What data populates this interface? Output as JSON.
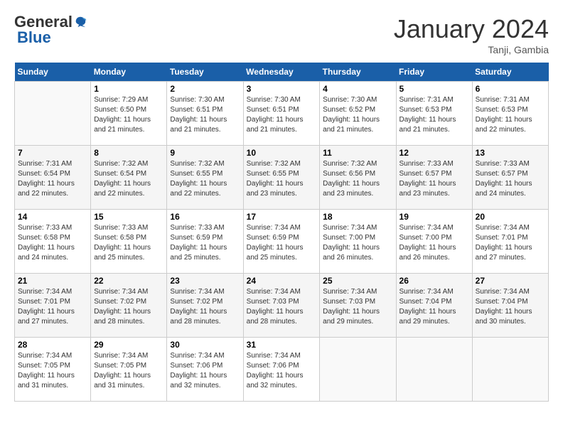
{
  "header": {
    "logo_general": "General",
    "logo_blue": "Blue",
    "month_title": "January 2024",
    "location": "Tanji, Gambia"
  },
  "days_of_week": [
    "Sunday",
    "Monday",
    "Tuesday",
    "Wednesday",
    "Thursday",
    "Friday",
    "Saturday"
  ],
  "weeks": [
    [
      null,
      {
        "num": "1",
        "sunrise": "7:29 AM",
        "sunset": "6:50 PM",
        "daylight": "11 hours and 21 minutes."
      },
      {
        "num": "2",
        "sunrise": "7:30 AM",
        "sunset": "6:51 PM",
        "daylight": "11 hours and 21 minutes."
      },
      {
        "num": "3",
        "sunrise": "7:30 AM",
        "sunset": "6:51 PM",
        "daylight": "11 hours and 21 minutes."
      },
      {
        "num": "4",
        "sunrise": "7:30 AM",
        "sunset": "6:52 PM",
        "daylight": "11 hours and 21 minutes."
      },
      {
        "num": "5",
        "sunrise": "7:31 AM",
        "sunset": "6:53 PM",
        "daylight": "11 hours and 21 minutes."
      },
      {
        "num": "6",
        "sunrise": "7:31 AM",
        "sunset": "6:53 PM",
        "daylight": "11 hours and 22 minutes."
      }
    ],
    [
      {
        "num": "7",
        "sunrise": "7:31 AM",
        "sunset": "6:54 PM",
        "daylight": "11 hours and 22 minutes."
      },
      {
        "num": "8",
        "sunrise": "7:32 AM",
        "sunset": "6:54 PM",
        "daylight": "11 hours and 22 minutes."
      },
      {
        "num": "9",
        "sunrise": "7:32 AM",
        "sunset": "6:55 PM",
        "daylight": "11 hours and 22 minutes."
      },
      {
        "num": "10",
        "sunrise": "7:32 AM",
        "sunset": "6:55 PM",
        "daylight": "11 hours and 23 minutes."
      },
      {
        "num": "11",
        "sunrise": "7:32 AM",
        "sunset": "6:56 PM",
        "daylight": "11 hours and 23 minutes."
      },
      {
        "num": "12",
        "sunrise": "7:33 AM",
        "sunset": "6:57 PM",
        "daylight": "11 hours and 23 minutes."
      },
      {
        "num": "13",
        "sunrise": "7:33 AM",
        "sunset": "6:57 PM",
        "daylight": "11 hours and 24 minutes."
      }
    ],
    [
      {
        "num": "14",
        "sunrise": "7:33 AM",
        "sunset": "6:58 PM",
        "daylight": "11 hours and 24 minutes."
      },
      {
        "num": "15",
        "sunrise": "7:33 AM",
        "sunset": "6:58 PM",
        "daylight": "11 hours and 25 minutes."
      },
      {
        "num": "16",
        "sunrise": "7:33 AM",
        "sunset": "6:59 PM",
        "daylight": "11 hours and 25 minutes."
      },
      {
        "num": "17",
        "sunrise": "7:34 AM",
        "sunset": "6:59 PM",
        "daylight": "11 hours and 25 minutes."
      },
      {
        "num": "18",
        "sunrise": "7:34 AM",
        "sunset": "7:00 PM",
        "daylight": "11 hours and 26 minutes."
      },
      {
        "num": "19",
        "sunrise": "7:34 AM",
        "sunset": "7:00 PM",
        "daylight": "11 hours and 26 minutes."
      },
      {
        "num": "20",
        "sunrise": "7:34 AM",
        "sunset": "7:01 PM",
        "daylight": "11 hours and 27 minutes."
      }
    ],
    [
      {
        "num": "21",
        "sunrise": "7:34 AM",
        "sunset": "7:01 PM",
        "daylight": "11 hours and 27 minutes."
      },
      {
        "num": "22",
        "sunrise": "7:34 AM",
        "sunset": "7:02 PM",
        "daylight": "11 hours and 28 minutes."
      },
      {
        "num": "23",
        "sunrise": "7:34 AM",
        "sunset": "7:02 PM",
        "daylight": "11 hours and 28 minutes."
      },
      {
        "num": "24",
        "sunrise": "7:34 AM",
        "sunset": "7:03 PM",
        "daylight": "11 hours and 28 minutes."
      },
      {
        "num": "25",
        "sunrise": "7:34 AM",
        "sunset": "7:03 PM",
        "daylight": "11 hours and 29 minutes."
      },
      {
        "num": "26",
        "sunrise": "7:34 AM",
        "sunset": "7:04 PM",
        "daylight": "11 hours and 29 minutes."
      },
      {
        "num": "27",
        "sunrise": "7:34 AM",
        "sunset": "7:04 PM",
        "daylight": "11 hours and 30 minutes."
      }
    ],
    [
      {
        "num": "28",
        "sunrise": "7:34 AM",
        "sunset": "7:05 PM",
        "daylight": "11 hours and 31 minutes."
      },
      {
        "num": "29",
        "sunrise": "7:34 AM",
        "sunset": "7:05 PM",
        "daylight": "11 hours and 31 minutes."
      },
      {
        "num": "30",
        "sunrise": "7:34 AM",
        "sunset": "7:06 PM",
        "daylight": "11 hours and 32 minutes."
      },
      {
        "num": "31",
        "sunrise": "7:34 AM",
        "sunset": "7:06 PM",
        "daylight": "11 hours and 32 minutes."
      },
      null,
      null,
      null
    ]
  ],
  "labels": {
    "sunrise": "Sunrise:",
    "sunset": "Sunset:",
    "daylight": "Daylight:"
  }
}
